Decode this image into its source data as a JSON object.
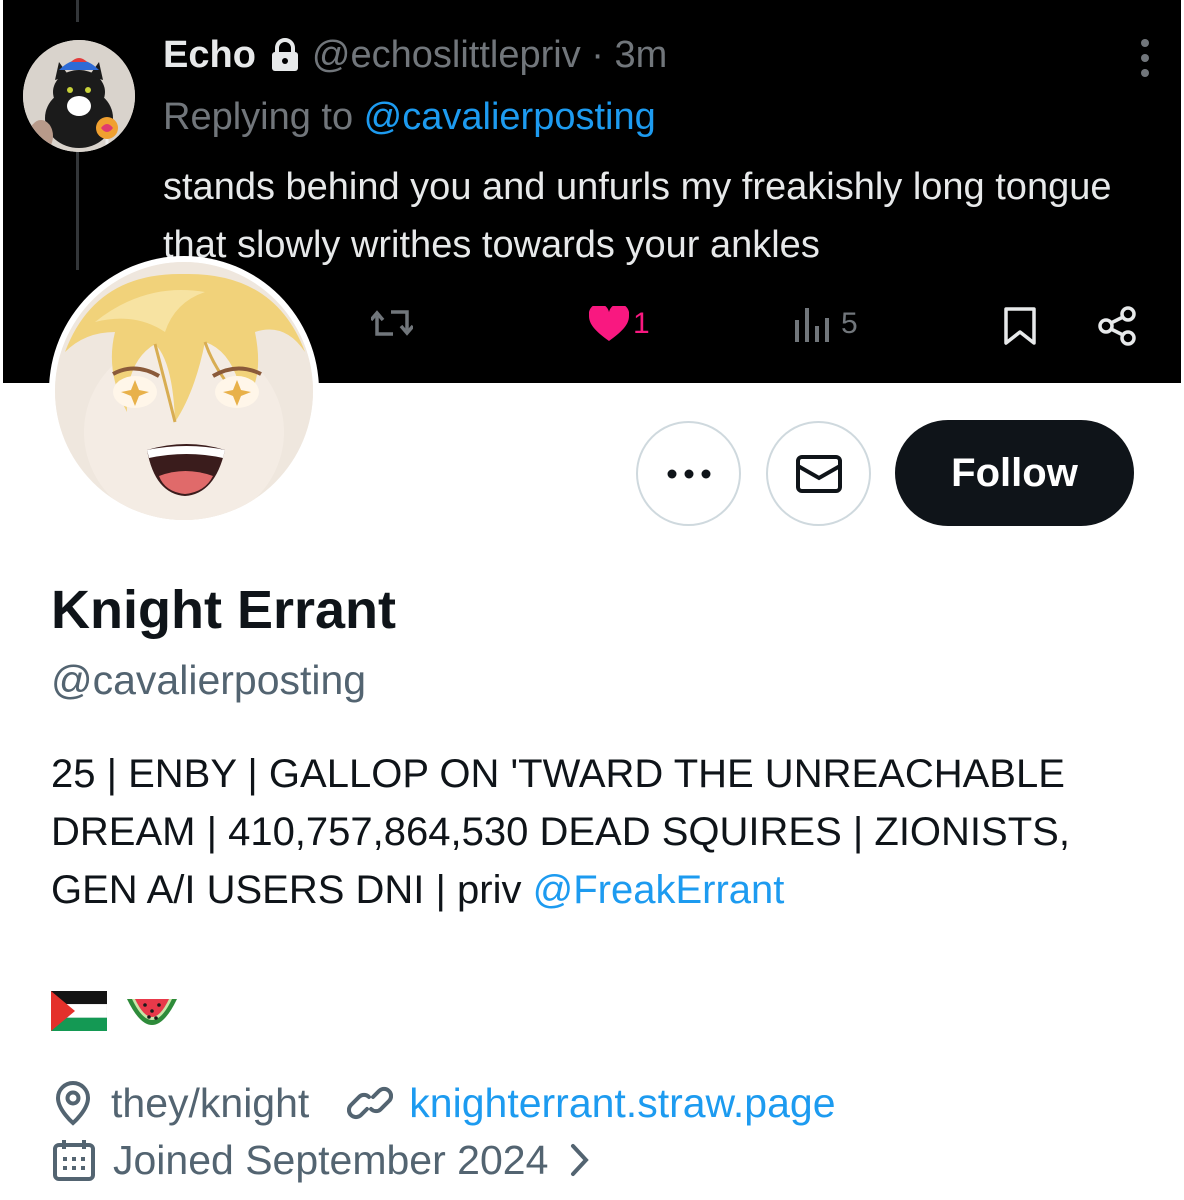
{
  "tweet": {
    "author_name": "Echo",
    "author_handle": "@echoslittlepriv",
    "separator": " · ",
    "time": "3m",
    "replying_prefix": "Replying to ",
    "replying_mention": "@cavalierposting",
    "text": "stands behind you and unfurls my freakishly long tongue that slowly writhes towards your ankles",
    "likes": "1",
    "views": "5"
  },
  "profile": {
    "display_name": "Knight Errant",
    "handle": "@cavalierposting",
    "bio_text": "25 | ENBY | GALLOP ON 'TWARD THE UNREACHABLE DREAM | 410,757,864,530 DEAD SQUIRES | ZIONISTS, GEN A/I USERS DNI | priv ",
    "bio_mention": "@FreakErrant",
    "emoji": [
      "palestine-flag",
      "watermelon"
    ],
    "pronouns": "they/knight",
    "website": "knighterrant.straw.page",
    "joined": "Joined September 2024"
  },
  "actions": {
    "follow_label": "Follow"
  },
  "colors": {
    "accent": "#1d9bf0",
    "like": "#f91880",
    "follow_bg": "#0f1419"
  }
}
